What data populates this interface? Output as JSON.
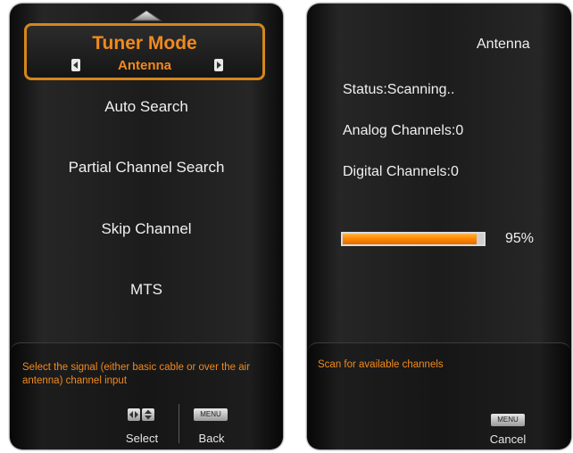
{
  "left_panel": {
    "tuner_title": "Tuner Mode",
    "tuner_value": "Antenna",
    "menu_items": [
      "Auto Search",
      "Partial Channel Search",
      "Skip Channel",
      "MTS"
    ],
    "help_text": "Select the signal (either basic cable or over the air antenna) channel input",
    "keys": {
      "select_label": "Select",
      "menu_key_text": "MENU",
      "back_label": "Back"
    }
  },
  "right_panel": {
    "source": "Antenna",
    "status": "Status:Scanning..",
    "analog": "Analog Channels:0",
    "digital": "Digital Channels:0",
    "progress": {
      "value": 0.95,
      "label": "95%"
    },
    "help_text": "Scan for available channels",
    "keys": {
      "menu_key_text": "MENU",
      "cancel_label": "Cancel"
    }
  },
  "colors": {
    "accent": "#f08a1e",
    "progress_fill": "#ff8a00"
  },
  "icons": [
    "up-arrow-icon",
    "left-arrow-icon",
    "right-arrow-icon",
    "navigation-keys-icon",
    "menu-key-icon"
  ]
}
